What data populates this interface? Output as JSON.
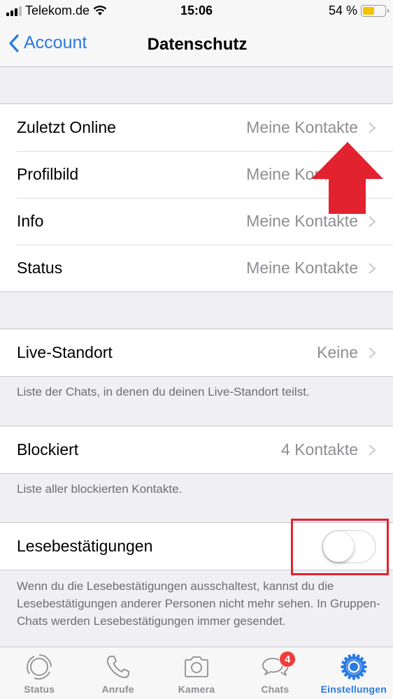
{
  "status_bar": {
    "carrier": "Telekom.de",
    "time": "15:06",
    "battery_text": "54 %",
    "battery_level": 0.54,
    "battery_color": "#f6c300"
  },
  "nav": {
    "back_label": "Account",
    "title": "Datenschutz"
  },
  "privacy_rows": [
    {
      "label": "Zuletzt Online",
      "value": "Meine Kontakte"
    },
    {
      "label": "Profilbild",
      "value": "Meine Kontakte"
    },
    {
      "label": "Info",
      "value": "Meine Kontakte"
    },
    {
      "label": "Status",
      "value": "Meine Kontakte"
    }
  ],
  "live_location": {
    "label": "Live-Standort",
    "value": "Keine",
    "footer": "Liste der Chats, in denen du deinen Live-Standort teilst."
  },
  "blocked": {
    "label": "Blockiert",
    "value": "4 Kontakte",
    "footer": "Liste aller blockierten Kontakte."
  },
  "read_receipts": {
    "label": "Lesebestätigungen",
    "enabled": false,
    "footer": "Wenn du die Lesebestätigungen ausschaltest, kannst du die Lesebestätigungen anderer Personen nicht mehr sehen. In Gruppen-Chats werden Lesebestätigungen immer gesendet."
  },
  "annotations": {
    "arrow_color": "#e3222f",
    "box_color": "#e3222f"
  },
  "tabs": [
    {
      "label": "Status",
      "icon": "status-icon",
      "active": false
    },
    {
      "label": "Anrufe",
      "icon": "phone-icon",
      "active": false
    },
    {
      "label": "Kamera",
      "icon": "camera-icon",
      "active": false
    },
    {
      "label": "Chats",
      "icon": "chats-icon",
      "active": false,
      "badge": "4"
    },
    {
      "label": "Einstellungen",
      "icon": "settings-gear-icon",
      "active": true
    }
  ],
  "colors": {
    "accent": "#2a7ae2",
    "badge": "#f23b3b"
  }
}
